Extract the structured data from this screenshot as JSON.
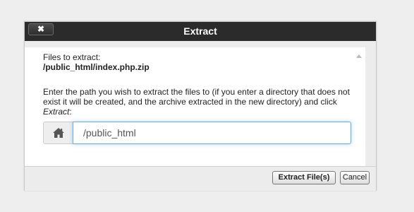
{
  "dialog": {
    "title": "Extract",
    "close_label": "✖"
  },
  "content": {
    "files_label": "Files to extract:",
    "files_path": "/public_html/index.php.zip",
    "instructions_main": "Enter the path you wish to extract the files to (if you enter a directory that does not exist it will be created, and the archive extracted in the new directory) and click ",
    "instructions_action": "Extract",
    "instructions_suffix": ":"
  },
  "path_input": {
    "value": "/public_html",
    "icon": "home-icon"
  },
  "footer": {
    "extract_label": "Extract File(s)",
    "cancel_label": "Cancel"
  },
  "colors": {
    "titlebar": "#2b2b2b",
    "focus_border": "#66afe9"
  }
}
